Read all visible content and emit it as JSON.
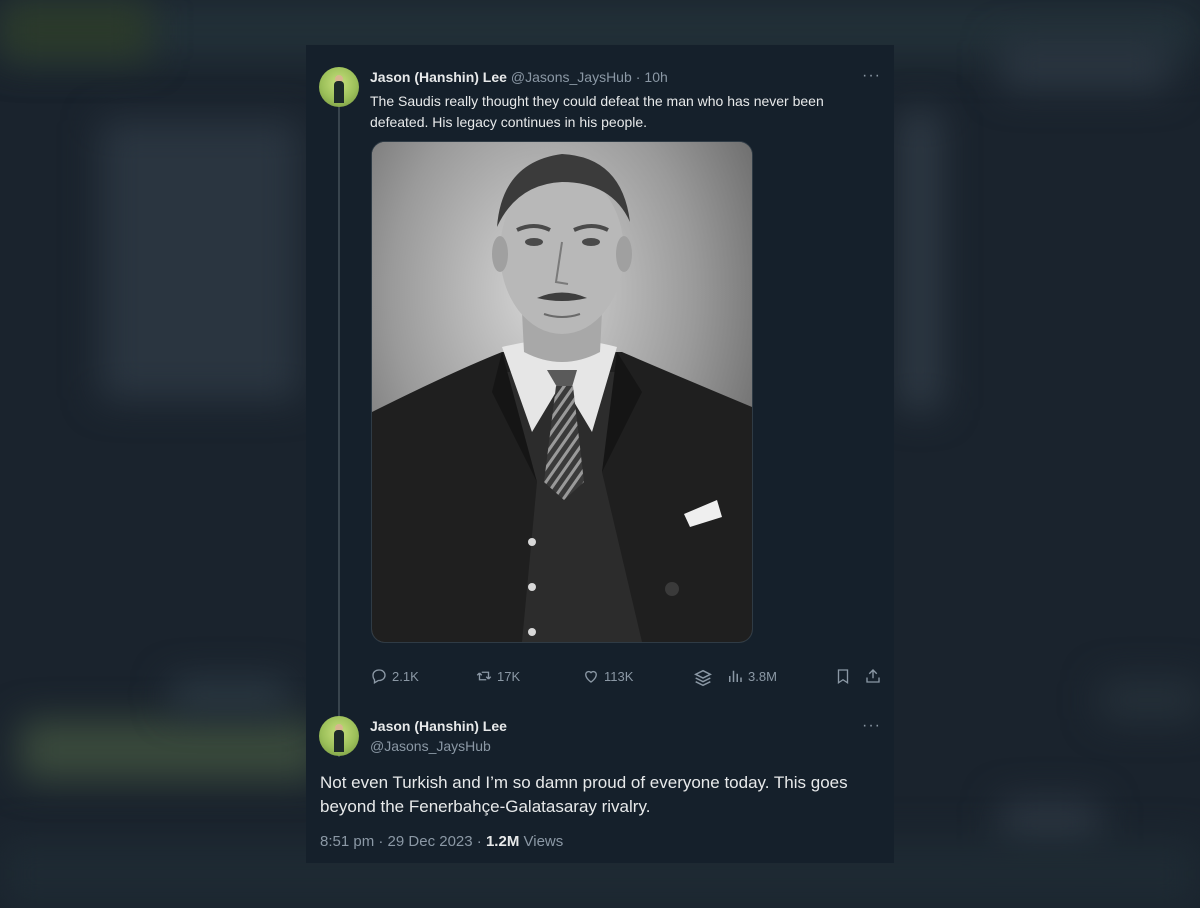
{
  "tweet1": {
    "name": "Jason (Hanshin) Lee",
    "handle": "@Jasons_JaysHub",
    "sep": "·",
    "time": "10h",
    "text": "The Saudis really thought they could defeat the man who has never been defeated. His legacy continues in his people.",
    "more": "···",
    "actions": {
      "replies": "2.1K",
      "reposts": "17K",
      "likes": "113K",
      "views": "3.8M"
    }
  },
  "tweet2": {
    "name": "Jason (Hanshin) Lee",
    "handle": "@Jasons_JaysHub",
    "more": "···",
    "text": "Not even Turkish and I’m so damn proud of everyone today. This goes beyond the Fenerbahçe-Galatasaray rivalry.",
    "time": "8:51 pm",
    "date": "29 Dec 2023",
    "views_count": "1.2M",
    "views_label": "Views",
    "sep": "·"
  },
  "colors": {
    "card_bg": "#15202b",
    "text": "#e7e9ea",
    "muted": "#8b98a5"
  }
}
